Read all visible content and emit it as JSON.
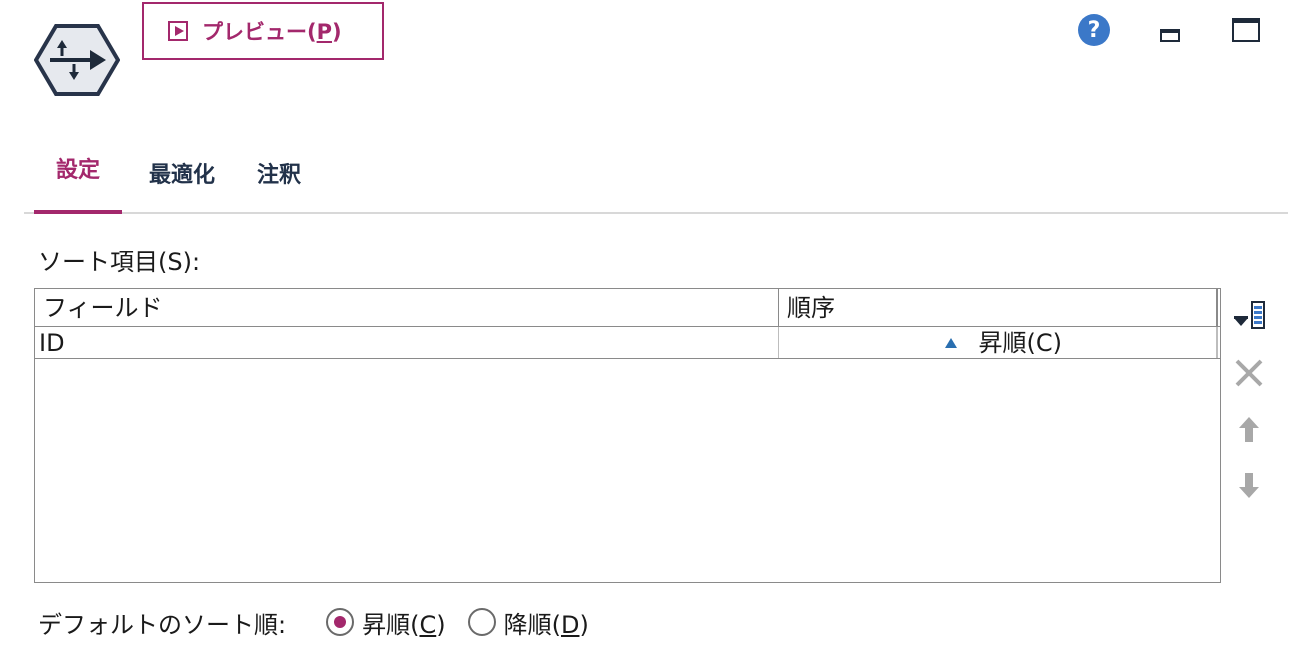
{
  "toolbar": {
    "preview_label": "プレビュー(",
    "preview_mnemonic": "P",
    "preview_suffix": ")",
    "help_glyph": "?"
  },
  "tabs": [
    {
      "label": "設定",
      "active": true
    },
    {
      "label": "最適化",
      "active": false
    },
    {
      "label": "注釈",
      "active": false
    }
  ],
  "sort_section": {
    "label": "ソート項目(S):",
    "columns": [
      "フィールド",
      "順序"
    ],
    "rows": [
      {
        "field": "ID",
        "order": "昇順(C)"
      }
    ]
  },
  "default_order": {
    "label": "デフォルトのソート順:",
    "ascending": {
      "label": "昇順(",
      "mnemonic": "C",
      "suffix": ")",
      "selected": true
    },
    "descending": {
      "label": "降順(",
      "mnemonic": "D",
      "suffix": ")",
      "selected": false
    }
  },
  "icons": {
    "node": "sort-node-icon",
    "help": "help-icon",
    "minimize": "minimize-icon",
    "maximize": "maximize-icon",
    "add_field": "add-field-icon",
    "delete": "delete-icon",
    "move_up": "move-up-icon",
    "move_down": "move-down-icon"
  },
  "colors": {
    "accent": "#a3286c",
    "help_blue": "#3b78c8",
    "ascending_marker": "#2a6fb0",
    "disabled_tool": "#a8a8a8"
  }
}
